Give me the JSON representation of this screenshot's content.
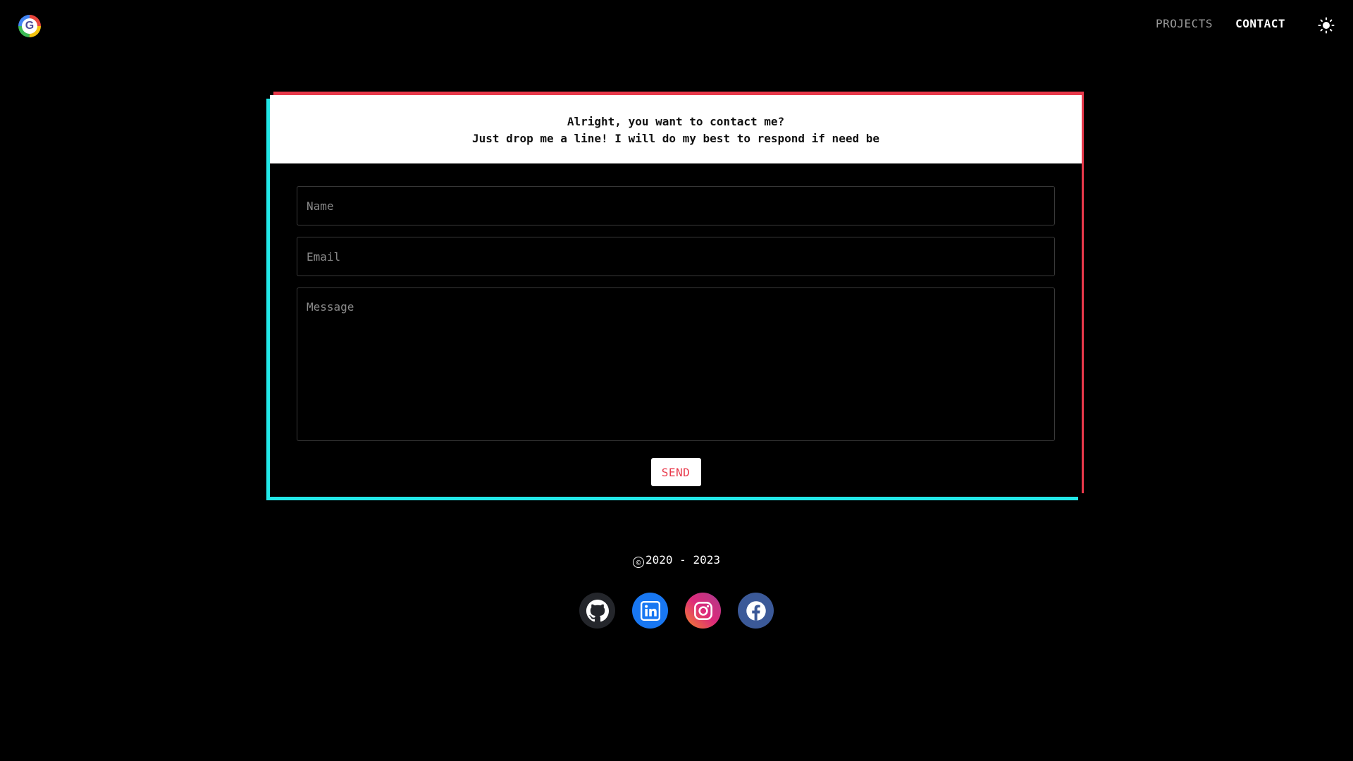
{
  "header": {
    "logo_letter": "G",
    "nav": {
      "projects": "PROJECTS",
      "contact": "CONTACT"
    },
    "theme_icon": "sun-icon"
  },
  "contact_card": {
    "intro_line1": "Alright, you want to contact me?",
    "intro_line2": "Just drop me a line! I will do my best to respond if need be",
    "form": {
      "name_placeholder": "Name",
      "name_value": "",
      "email_placeholder": "Email",
      "email_value": "",
      "message_placeholder": "Message",
      "message_value": "",
      "send_label": "SEND"
    }
  },
  "footer": {
    "copyright_symbol": "©",
    "copyright_years": "2020 - 2023",
    "socials": [
      {
        "name": "github-icon"
      },
      {
        "name": "linkedin-icon"
      },
      {
        "name": "instagram-icon"
      },
      {
        "name": "facebook-icon"
      }
    ]
  },
  "colors": {
    "background": "#000000",
    "accent_red": "#e8394b",
    "accent_cyan": "#22e8e8",
    "nav_inactive": "#9a9a9a"
  }
}
